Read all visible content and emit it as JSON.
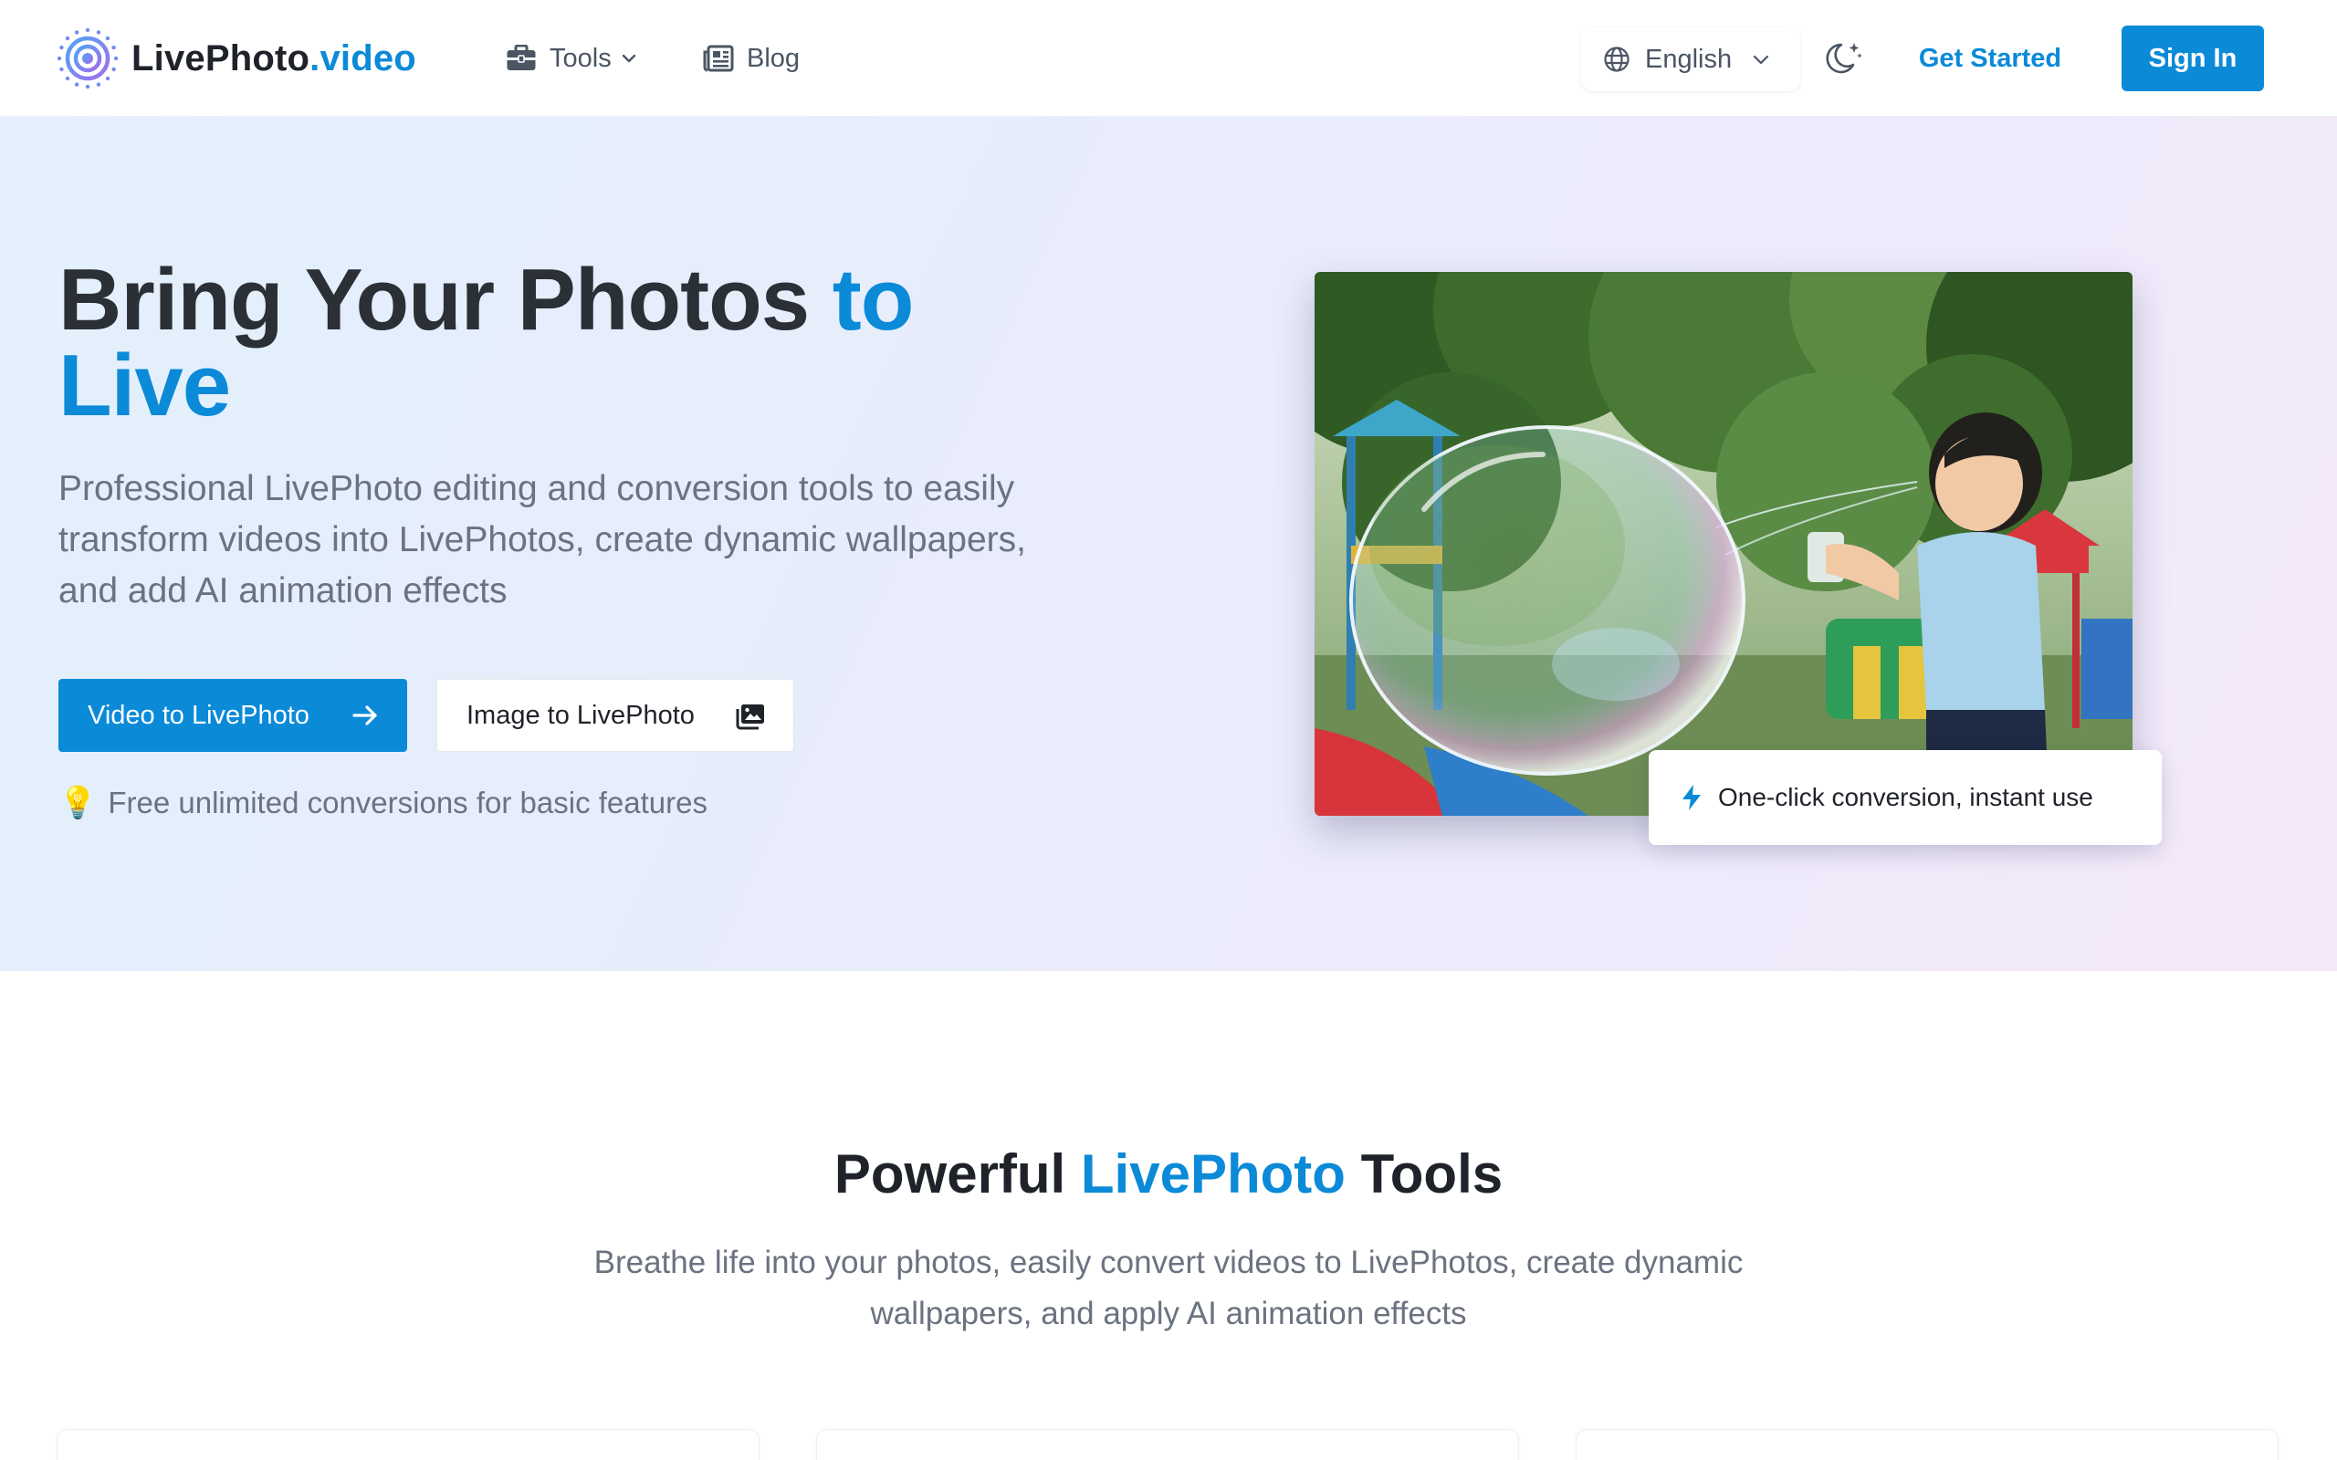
{
  "header": {
    "logo": {
      "name": "LivePhoto",
      "suffix": ".video"
    },
    "nav": {
      "tools_label": "Tools",
      "blog_label": "Blog"
    },
    "language": "English",
    "get_started_label": "Get Started",
    "sign_in_label": "Sign In"
  },
  "hero": {
    "title_main": "Bring Your Photos ",
    "title_accent_1": "to",
    "title_accent_2": "Live",
    "subtitle": "Professional LivePhoto editing and conversion tools to easily transform videos into LivePhotos, create dynamic wallpapers, and add AI animation effects",
    "primary_button": "Video to LivePhoto",
    "secondary_button": "Image to LivePhoto",
    "note_emoji": "💡",
    "note": "Free unlimited conversions for basic features",
    "badge": "One-click conversion, instant use"
  },
  "tools_section": {
    "title_start": "Powerful ",
    "title_accent": "LivePhoto",
    "title_end": " Tools",
    "subtitle": "Breathe life into your photos, easily convert videos to LivePhotos, create dynamic wallpapers, and apply AI animation effects"
  },
  "colors": {
    "brand": "#0b8ad8",
    "text": "#1f2329",
    "muted": "#6b7280"
  },
  "icons": {
    "logo": "livephoto-logo-icon",
    "tools": "toolbox-icon",
    "blog": "newspaper-icon",
    "language": "globe-icon",
    "theme": "moon-stars-icon",
    "primary_button": "arrow-right-icon",
    "secondary_button": "images-icon",
    "badge": "lightning-icon"
  }
}
